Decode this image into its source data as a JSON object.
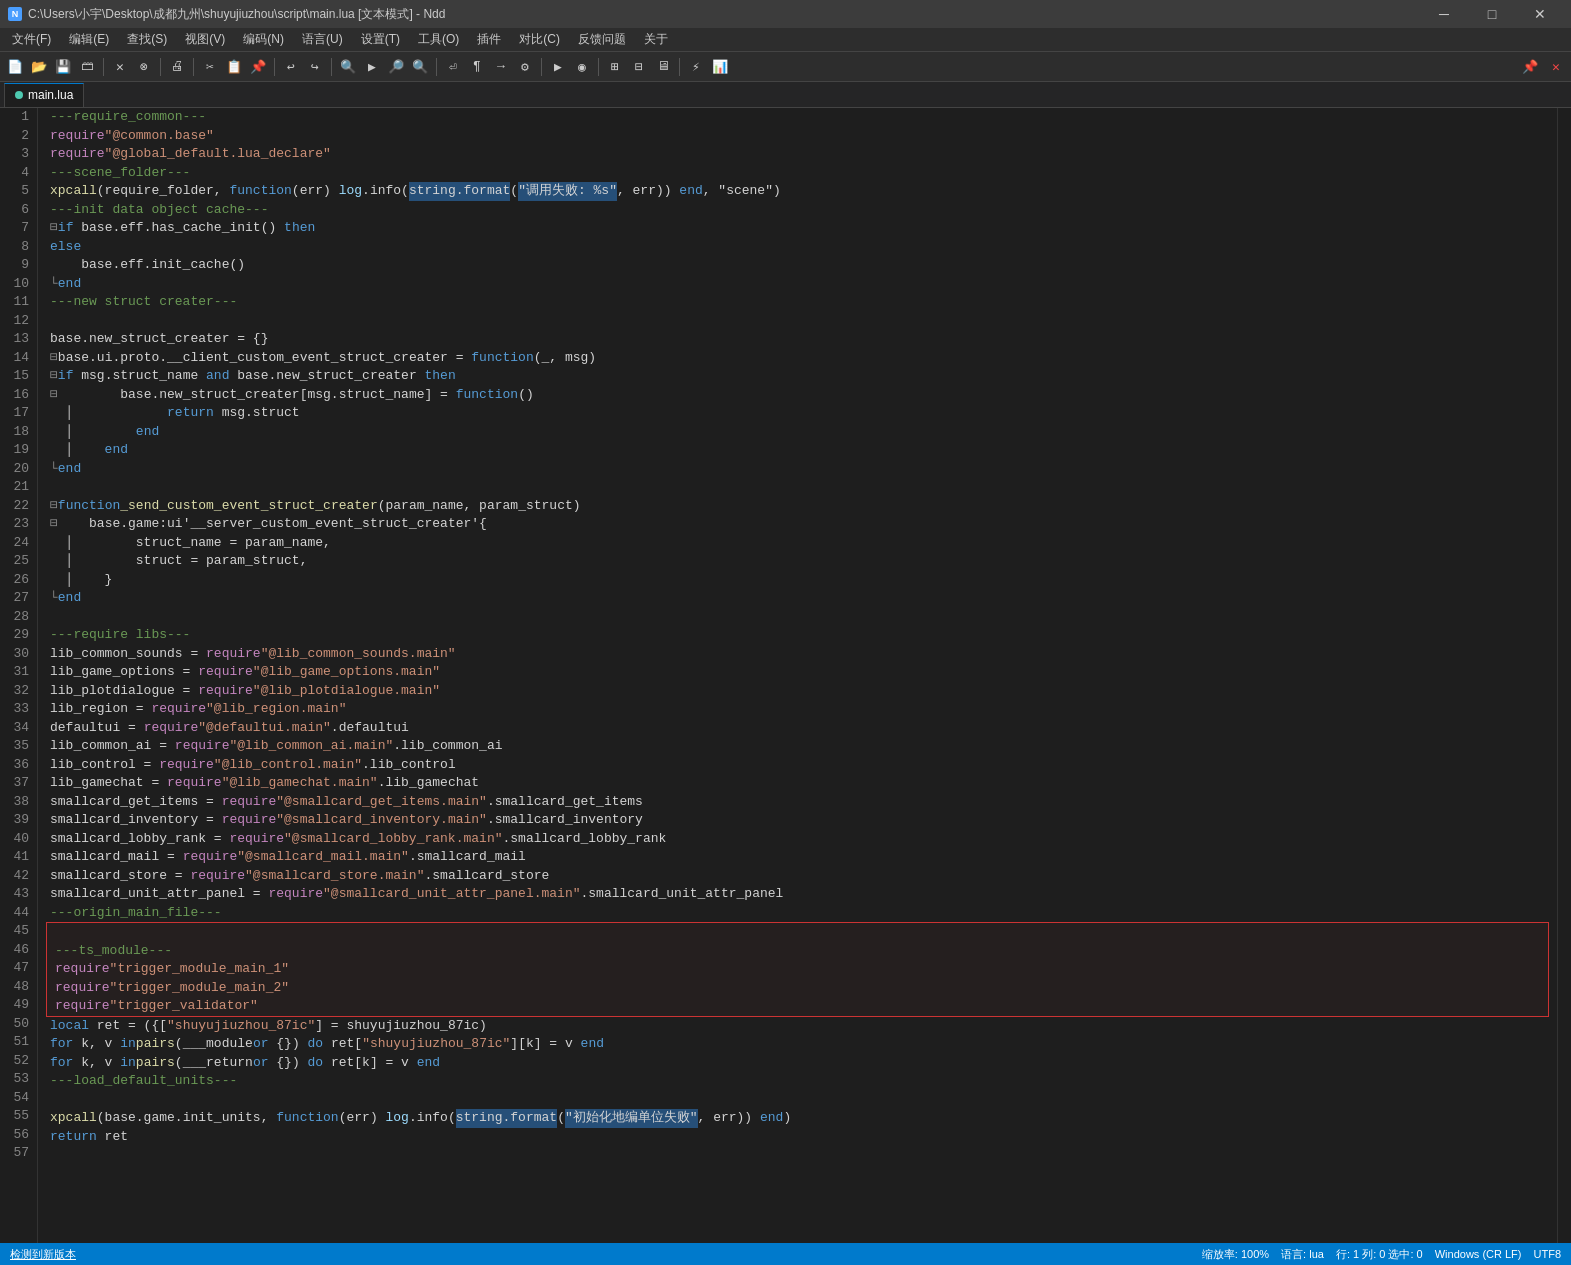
{
  "titleBar": {
    "icon": "N",
    "title": "C:\\Users\\小宇\\Desktop\\成都九州\\shuyujiuzhou\\script\\main.lua [文本模式] - Ndd",
    "minBtn": "─",
    "maxBtn": "□",
    "closeBtn": "✕"
  },
  "menuBar": {
    "items": [
      "文件(F)",
      "编辑(E)",
      "查找(S)",
      "视图(V)",
      "编码(N)",
      "语言(U)",
      "设置(T)",
      "工具(O)",
      "插件",
      "对比(C)",
      "反馈问题",
      "关于"
    ]
  },
  "tab": {
    "label": "main.lua",
    "active": true
  },
  "statusBar": {
    "update": "检测到新版本",
    "zoom": "缩放率: 100%",
    "lang": "语言: lua",
    "pos": "行: 1 列: 0 选中: 0",
    "eol": "Windows (CR LF)",
    "encoding": "UTF8"
  },
  "lines": [
    {
      "num": 1,
      "content": "---require_common---"
    },
    {
      "num": 2,
      "content": "require\"@common.base\""
    },
    {
      "num": 3,
      "content": "require\"@global_default.lua_declare\""
    },
    {
      "num": 4,
      "content": "---scene_folder---"
    },
    {
      "num": 5,
      "content": "xpcall(require_folder, function(err) log.info(string.format(\"调用失败: %s\", err)) end, \"scene\")"
    },
    {
      "num": 6,
      "content": "---init data object cache---"
    },
    {
      "num": 7,
      "content": "if base.eff.has_cache_init() then"
    },
    {
      "num": 8,
      "content": "else"
    },
    {
      "num": 9,
      "content": "    base.eff.init_cache()"
    },
    {
      "num": 10,
      "content": "end"
    },
    {
      "num": 11,
      "content": "---new struct creater---"
    },
    {
      "num": 12,
      "content": ""
    },
    {
      "num": 13,
      "content": "base.new_struct_creater = {}"
    },
    {
      "num": 14,
      "content": "base.ui.proto.__client_custom_event_struct_creater = function(_, msg)"
    },
    {
      "num": 15,
      "content": "    if msg.struct_name and base.new_struct_creater then"
    },
    {
      "num": 16,
      "content": "        base.new_struct_creater[msg.struct_name] = function()"
    },
    {
      "num": 17,
      "content": "            return msg.struct"
    },
    {
      "num": 18,
      "content": "        end"
    },
    {
      "num": 19,
      "content": "    end"
    },
    {
      "num": 20,
      "content": "end"
    },
    {
      "num": 21,
      "content": ""
    },
    {
      "num": 22,
      "content": "function _send_custom_event_struct_creater(param_name, param_struct)"
    },
    {
      "num": 23,
      "content": "    base.game:ui'__server_custom_event_struct_creater'{"
    },
    {
      "num": 24,
      "content": "        struct_name = param_name,"
    },
    {
      "num": 25,
      "content": "        struct = param_struct,"
    },
    {
      "num": 26,
      "content": "    }"
    },
    {
      "num": 27,
      "content": "end"
    },
    {
      "num": 28,
      "content": ""
    },
    {
      "num": 29,
      "content": "---require libs---"
    },
    {
      "num": 30,
      "content": "lib_common_sounds = require\"@lib_common_sounds.main\""
    },
    {
      "num": 31,
      "content": "lib_game_options = require\"@lib_game_options.main\""
    },
    {
      "num": 32,
      "content": "lib_plotdialogue = require\"@lib_plotdialogue.main\""
    },
    {
      "num": 33,
      "content": "lib_region = require\"@lib_region.main\""
    },
    {
      "num": 34,
      "content": "defaultui = require\"@defaultui.main\".defaultui"
    },
    {
      "num": 35,
      "content": "lib_common_ai = require\"@lib_common_ai.main\".lib_common_ai"
    },
    {
      "num": 36,
      "content": "lib_control = require\"@lib_control.main\".lib_control"
    },
    {
      "num": 37,
      "content": "lib_gamechat = require\"@lib_gamechat.main\".lib_gamechat"
    },
    {
      "num": 38,
      "content": "smallcard_get_items = require\"@smallcard_get_items.main\".smallcard_get_items"
    },
    {
      "num": 39,
      "content": "smallcard_inventory = require\"@smallcard_inventory.main\".smallcard_inventory"
    },
    {
      "num": 40,
      "content": "smallcard_lobby_rank = require\"@smallcard_lobby_rank.main\".smallcard_lobby_rank"
    },
    {
      "num": 41,
      "content": "smallcard_mail = require\"@smallcard_mail.main\".smallcard_mail"
    },
    {
      "num": 42,
      "content": "smallcard_store = require\"@smallcard_store.main\".smallcard_store"
    },
    {
      "num": 43,
      "content": "smallcard_unit_attr_panel = require\"@smallcard_unit_attr_panel.main\".smallcard_unit_attr_panel"
    },
    {
      "num": 44,
      "content": "---origin_main_file---"
    },
    {
      "num": 45,
      "content": ""
    },
    {
      "num": 46,
      "content": "---ts_module---"
    },
    {
      "num": 47,
      "content": "require \"trigger_module_main_1\""
    },
    {
      "num": 48,
      "content": "require \"trigger_module_main_2\""
    },
    {
      "num": 49,
      "content": "require \"trigger_validator\""
    },
    {
      "num": 50,
      "content": "local ret = ({[\"shuyujiuzhou_87ic\"] = shuyujiuzhou_87ic)"
    },
    {
      "num": 51,
      "content": "for k, v in pairs(___module or {}) do ret[\"shuyujiuzhou_87ic\"][k] = v end"
    },
    {
      "num": 52,
      "content": "for k, v in pairs(___return or {}) do ret[k] = v end"
    },
    {
      "num": 53,
      "content": "---load_default_units---"
    },
    {
      "num": 54,
      "content": ""
    },
    {
      "num": 55,
      "content": "xpcall(base.game.init_units, function(err) log.info(string.format(\"初始化地编单位失败\", err)) end)"
    },
    {
      "num": 56,
      "content": "return ret"
    },
    {
      "num": 57,
      "content": ""
    }
  ]
}
